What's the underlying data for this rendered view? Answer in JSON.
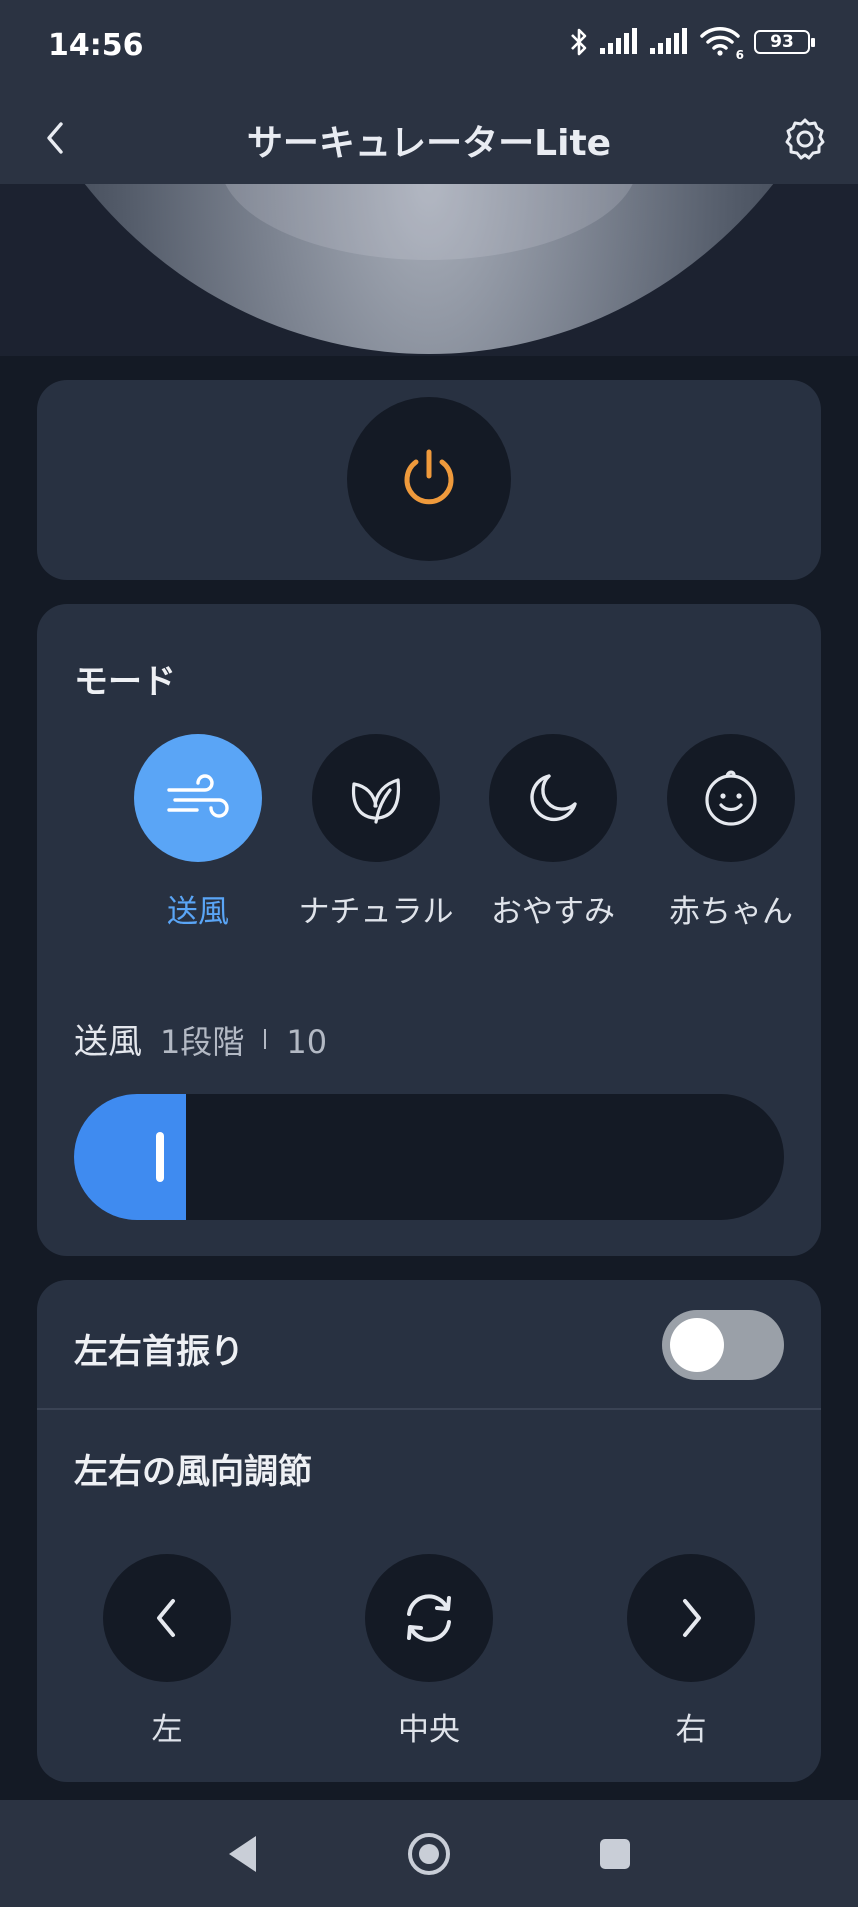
{
  "status_bar": {
    "time": "14:56",
    "battery": "93",
    "wifi_badge": "6",
    "icons": [
      "bluetooth-icon",
      "cell-signal-icon",
      "cell-signal-icon",
      "wifi-icon",
      "battery-icon"
    ]
  },
  "app_bar": {
    "title": "サーキュレーターLite",
    "back_icon": "chevron-left-icon",
    "settings_icon": "gear-icon"
  },
  "power": {
    "icon": "power-icon",
    "accent_color": "#ef9a3c"
  },
  "mode": {
    "title": "モード",
    "selected": "送風",
    "items": [
      {
        "label": "送風",
        "icon": "wind-icon",
        "active": true
      },
      {
        "label": "ナチュラル",
        "icon": "leaf-icon",
        "active": false
      },
      {
        "label": "おやすみ",
        "icon": "moon-icon",
        "active": false
      },
      {
        "label": "赤ちゃん",
        "icon": "baby-icon",
        "active": false
      }
    ],
    "accent_color": "#5aa5f6"
  },
  "speed": {
    "name": "送風",
    "level": "1段階",
    "max": "10",
    "value": 1,
    "max_value": 10,
    "fill_color": "#3f8bf0"
  },
  "swing": {
    "label": "左右首振り",
    "enabled": false
  },
  "direction": {
    "title": "左右の風向調節",
    "buttons": [
      {
        "label": "左",
        "icon": "chevron-left-icon"
      },
      {
        "label": "中央",
        "icon": "refresh-icon"
      },
      {
        "label": "右",
        "icon": "chevron-right-icon"
      }
    ]
  },
  "nav_bar": {
    "icons": [
      "back-triangle-icon",
      "home-circle-icon",
      "recents-square-icon"
    ]
  }
}
